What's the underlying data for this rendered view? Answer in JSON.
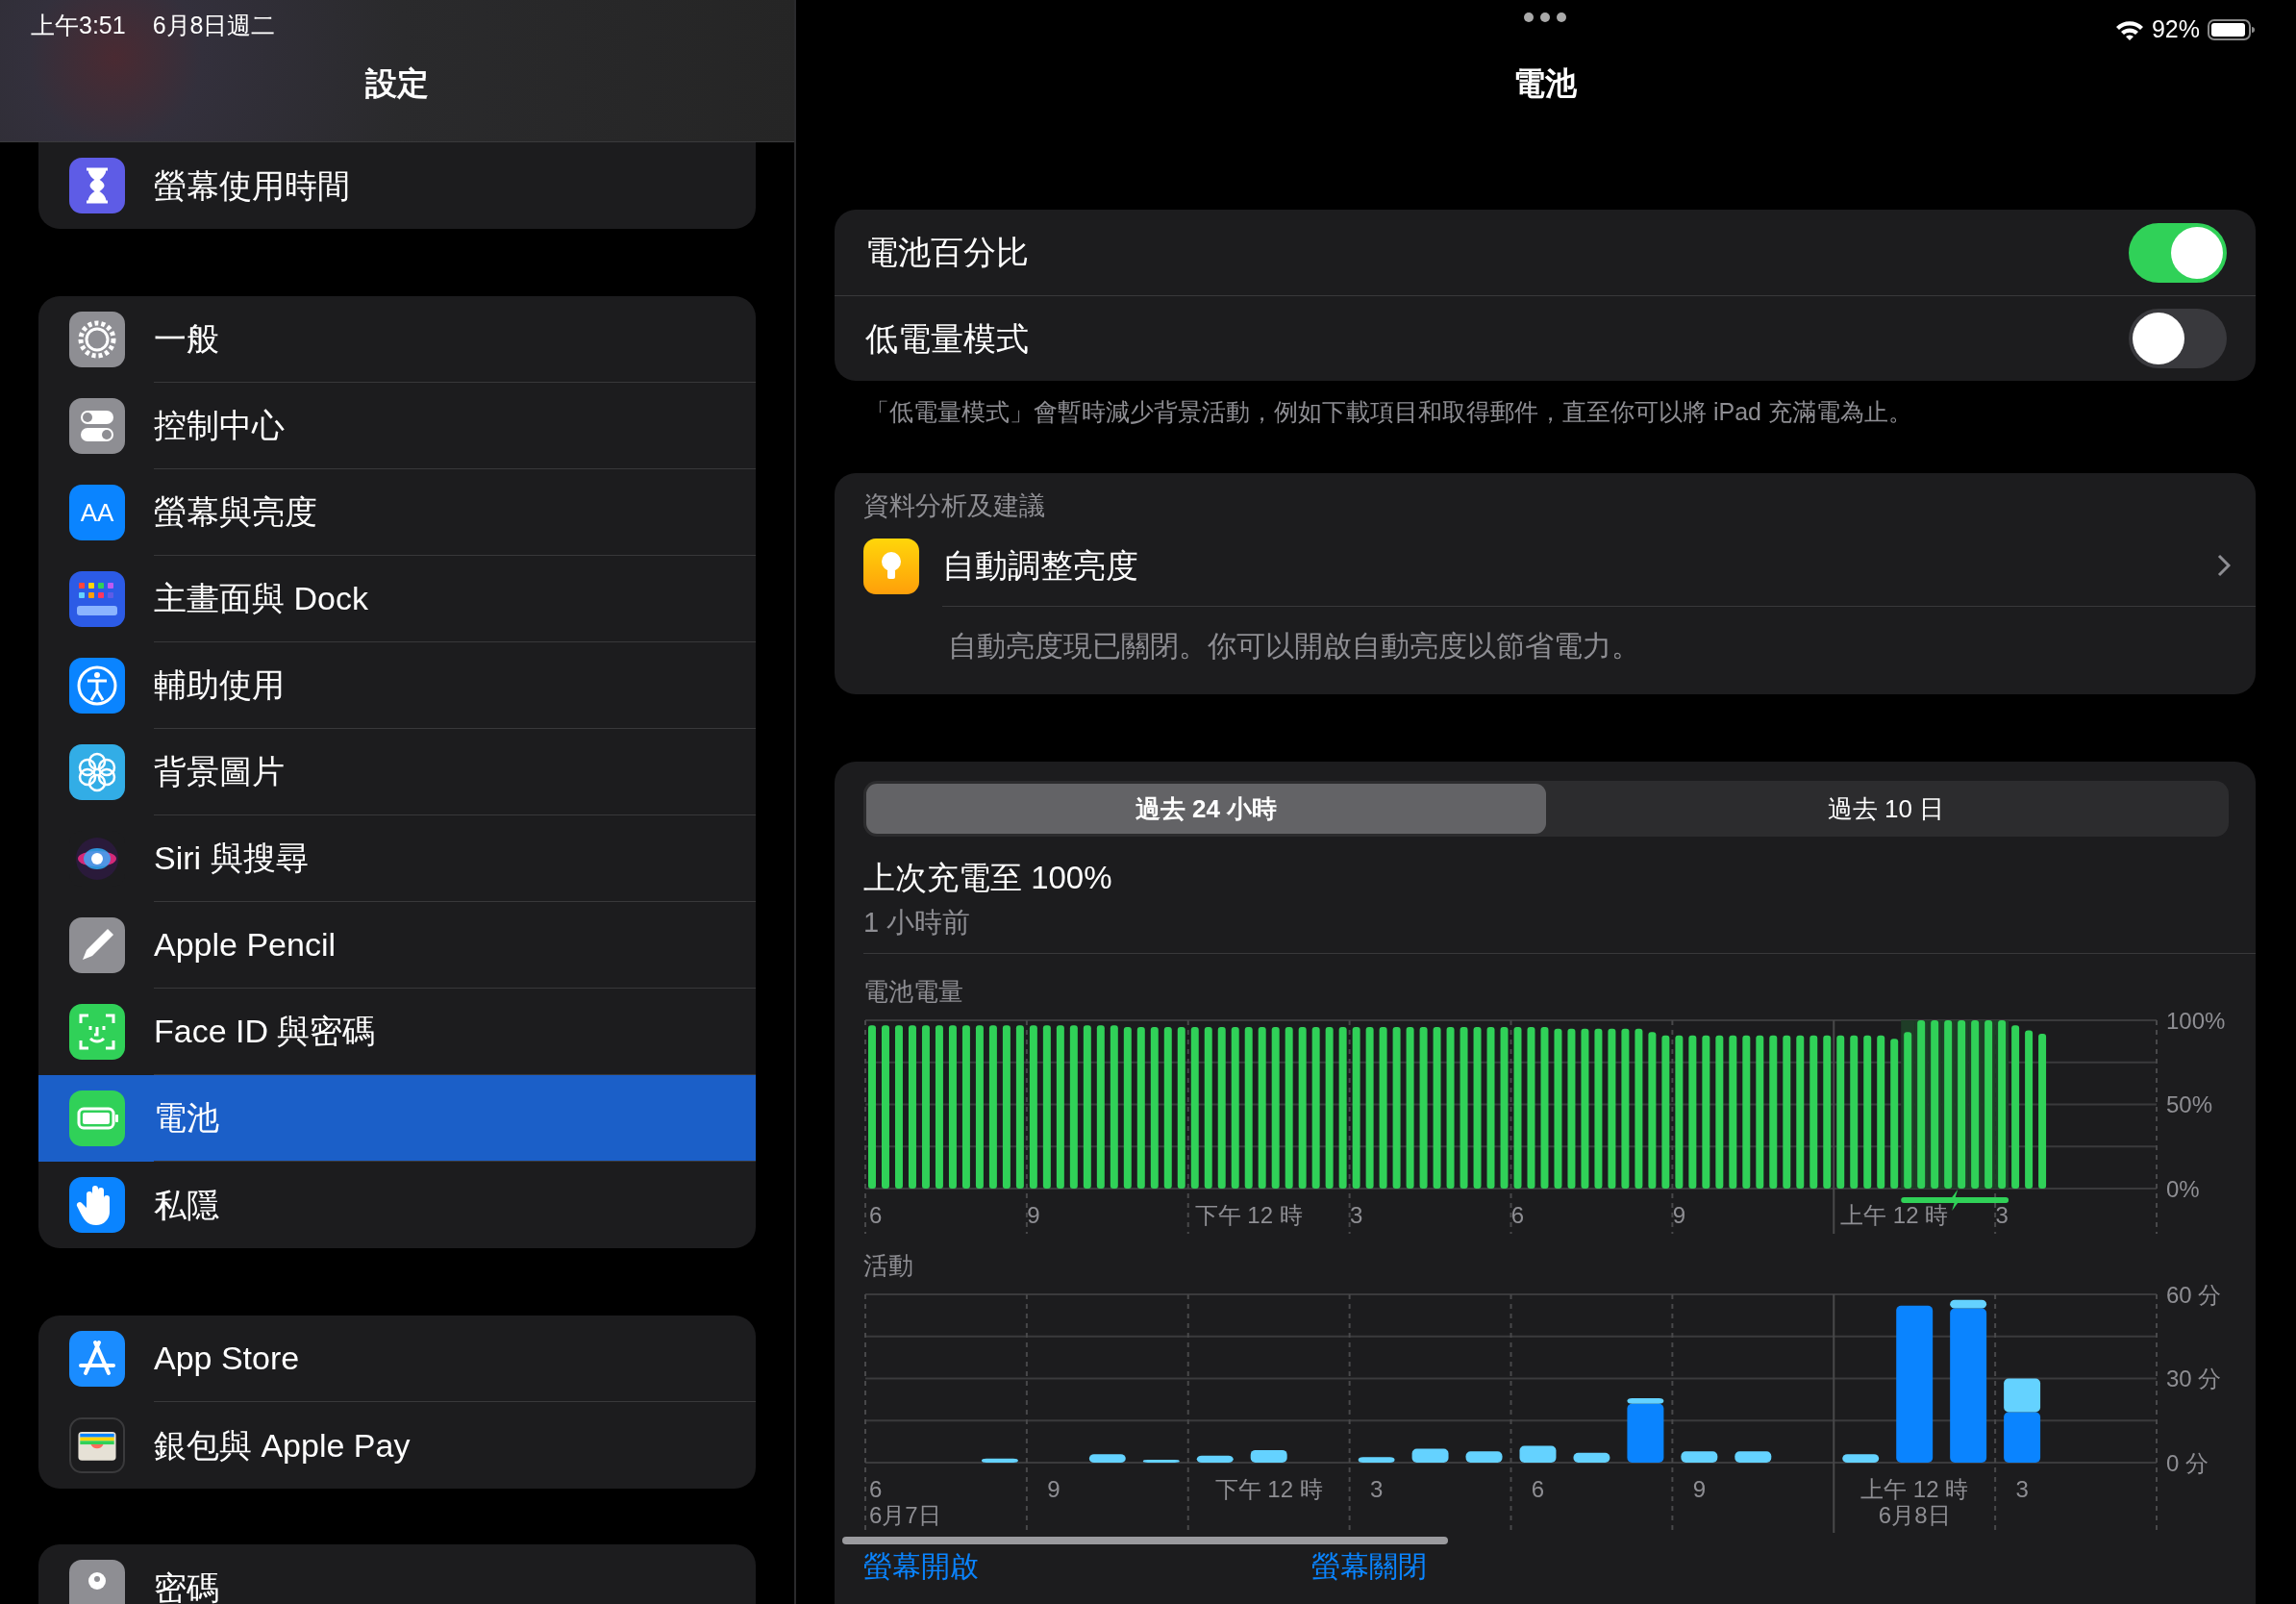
{
  "status_bar": {
    "time": "上午3:51",
    "date": "6月8日週二",
    "battery_percent": "92%"
  },
  "sidebar": {
    "title": "設定",
    "groups": [
      {
        "items": [
          {
            "label": "螢幕使用時間",
            "selected": false
          }
        ]
      },
      {
        "items": [
          {
            "label": "一般",
            "selected": false
          },
          {
            "label": "控制中心",
            "selected": false
          },
          {
            "label": "螢幕與亮度",
            "selected": false,
            "icon_text": "AA"
          },
          {
            "label": "主畫面與 Dock",
            "selected": false
          },
          {
            "label": "輔助使用",
            "selected": false
          },
          {
            "label": "背景圖片",
            "selected": false
          },
          {
            "label": "Siri 與搜尋",
            "selected": false
          },
          {
            "label": "Apple Pencil",
            "selected": false
          },
          {
            "label": "Face ID 與密碼",
            "selected": false
          },
          {
            "label": "電池",
            "selected": true
          },
          {
            "label": "私隱",
            "selected": false
          }
        ]
      },
      {
        "items": [
          {
            "label": "App Store",
            "selected": false
          },
          {
            "label": "銀包與 Apple Pay",
            "selected": false
          }
        ]
      },
      {
        "items": [
          {
            "label": "密碼",
            "selected": false
          }
        ]
      }
    ]
  },
  "detail": {
    "title": "電池",
    "toggles": [
      {
        "label": "電池百分比",
        "on": true
      },
      {
        "label": "低電量模式",
        "on": false
      }
    ],
    "toggles_footer": "「低電量模式」會暫時減少背景活動，例如下載項目和取得郵件，直至你可以將 iPad 充滿電為止。",
    "insights": {
      "header": "資料分析及建議",
      "title": "自動調整亮度",
      "description": "自動亮度現已關閉。你可以開啟自動亮度以節省電力。"
    },
    "usage": {
      "tabs": [
        {
          "label": "過去 24 小時",
          "selected": true
        },
        {
          "label": "過去 10 日",
          "selected": false
        }
      ],
      "last_charge": "上次充電至 100%",
      "last_charge_time": "1 小時前",
      "battery_level": {
        "title": "電池電量",
        "chart_data": {
          "type": "bar",
          "ylim": [
            0,
            100
          ],
          "yticks": [
            {
              "value": 0,
              "label": "0%"
            },
            {
              "value": 50,
              "label": "50%"
            },
            {
              "value": 100,
              "label": "100%"
            }
          ],
          "categories": [
            "6",
            null,
            null,
            null,
            null,
            null,
            null,
            null,
            null,
            null,
            null,
            null,
            "9",
            null,
            null,
            null,
            null,
            null,
            null,
            null,
            null,
            null,
            null,
            null,
            null,
            null,
            null,
            null,
            "下午 12 時",
            null,
            null,
            null,
            null,
            null,
            null,
            null,
            "3",
            null,
            null,
            null,
            null,
            null,
            null,
            null,
            null,
            null,
            null,
            null,
            "6",
            null,
            null,
            null,
            null,
            null,
            null,
            null,
            null,
            null,
            null,
            null,
            "9",
            null,
            null,
            null,
            null,
            null,
            null,
            null,
            null,
            null,
            null,
            null,
            null,
            null,
            null,
            null,
            "上午 12 時",
            null,
            null,
            null,
            null,
            null,
            null,
            null,
            "3",
            null,
            null,
            null,
            null,
            null,
            null,
            null,
            null,
            null,
            null,
            null
          ],
          "values": [
            97,
            97,
            97,
            97,
            97,
            97,
            97,
            97,
            97,
            97,
            97,
            97,
            97,
            97,
            97,
            97,
            97,
            97,
            97,
            96,
            96,
            96,
            96,
            96,
            96,
            96,
            96,
            96,
            96,
            96,
            96,
            96,
            96,
            96,
            96,
            96,
            96,
            96,
            96,
            96,
            96,
            96,
            96,
            96,
            96,
            96,
            96,
            96,
            96,
            96,
            96,
            95,
            95,
            95,
            95,
            95,
            95,
            95,
            93,
            91,
            91,
            91,
            91,
            91,
            91,
            91,
            91,
            91,
            91,
            91,
            91,
            91,
            91,
            91,
            91,
            91,
            89,
            93,
            100,
            100,
            100,
            100,
            100,
            100,
            100,
            97,
            94,
            92,
            null,
            null,
            null,
            null,
            null,
            null,
            null,
            null
          ]
        },
        "charging": [
          false,
          false,
          false,
          false,
          false,
          false,
          false,
          false,
          false,
          false,
          false,
          false,
          false,
          false,
          false,
          false,
          false,
          false,
          false,
          false,
          false,
          false,
          false,
          false,
          false,
          false,
          false,
          false,
          false,
          false,
          false,
          false,
          false,
          false,
          false,
          false,
          false,
          false,
          false,
          false,
          false,
          false,
          false,
          false,
          false,
          false,
          false,
          false,
          false,
          false,
          false,
          false,
          false,
          false,
          false,
          false,
          false,
          false,
          false,
          false,
          false,
          false,
          false,
          false,
          false,
          false,
          false,
          false,
          false,
          false,
          false,
          false,
          false,
          false,
          false,
          false,
          false,
          true,
          true,
          true,
          true,
          true,
          true,
          true,
          true,
          false,
          false,
          false
        ]
      },
      "activity": {
        "title": "活動",
        "chart_data": {
          "type": "bar",
          "stacked": true,
          "ylim": [
            0,
            60
          ],
          "yticks": [
            {
              "value": 0,
              "label": "0 分"
            },
            {
              "value": 30,
              "label": "30 分"
            },
            {
              "value": 60,
              "label": "60 分"
            }
          ],
          "categories": [
            "6\n6月7日",
            null,
            null,
            "9",
            null,
            null,
            null,
            "下午 12 時",
            null,
            "3",
            null,
            null,
            "6",
            null,
            null,
            "9",
            null,
            null,
            null,
            "上午 12 時\n6月8日",
            null,
            "3",
            null,
            null
          ],
          "series": [
            {
              "name": "螢幕開啟",
              "color": "#0a84ff",
              "values": [
                null,
                null,
                0,
                null,
                0,
                0,
                0,
                0,
                null,
                0,
                0,
                0,
                0,
                0,
                21,
                0,
                0,
                null,
                0,
                56,
                55,
                18,
                null,
                null
              ]
            },
            {
              "name": "螢幕關閉",
              "color": "#64d2ff",
              "values": [
                null,
                null,
                1.5,
                null,
                3,
                1,
                2.5,
                4.5,
                null,
                2,
                5,
                4,
                6,
                3.5,
                2,
                4,
                4,
                null,
                3,
                0,
                3,
                12,
                null,
                null
              ]
            }
          ]
        }
      }
    }
  }
}
